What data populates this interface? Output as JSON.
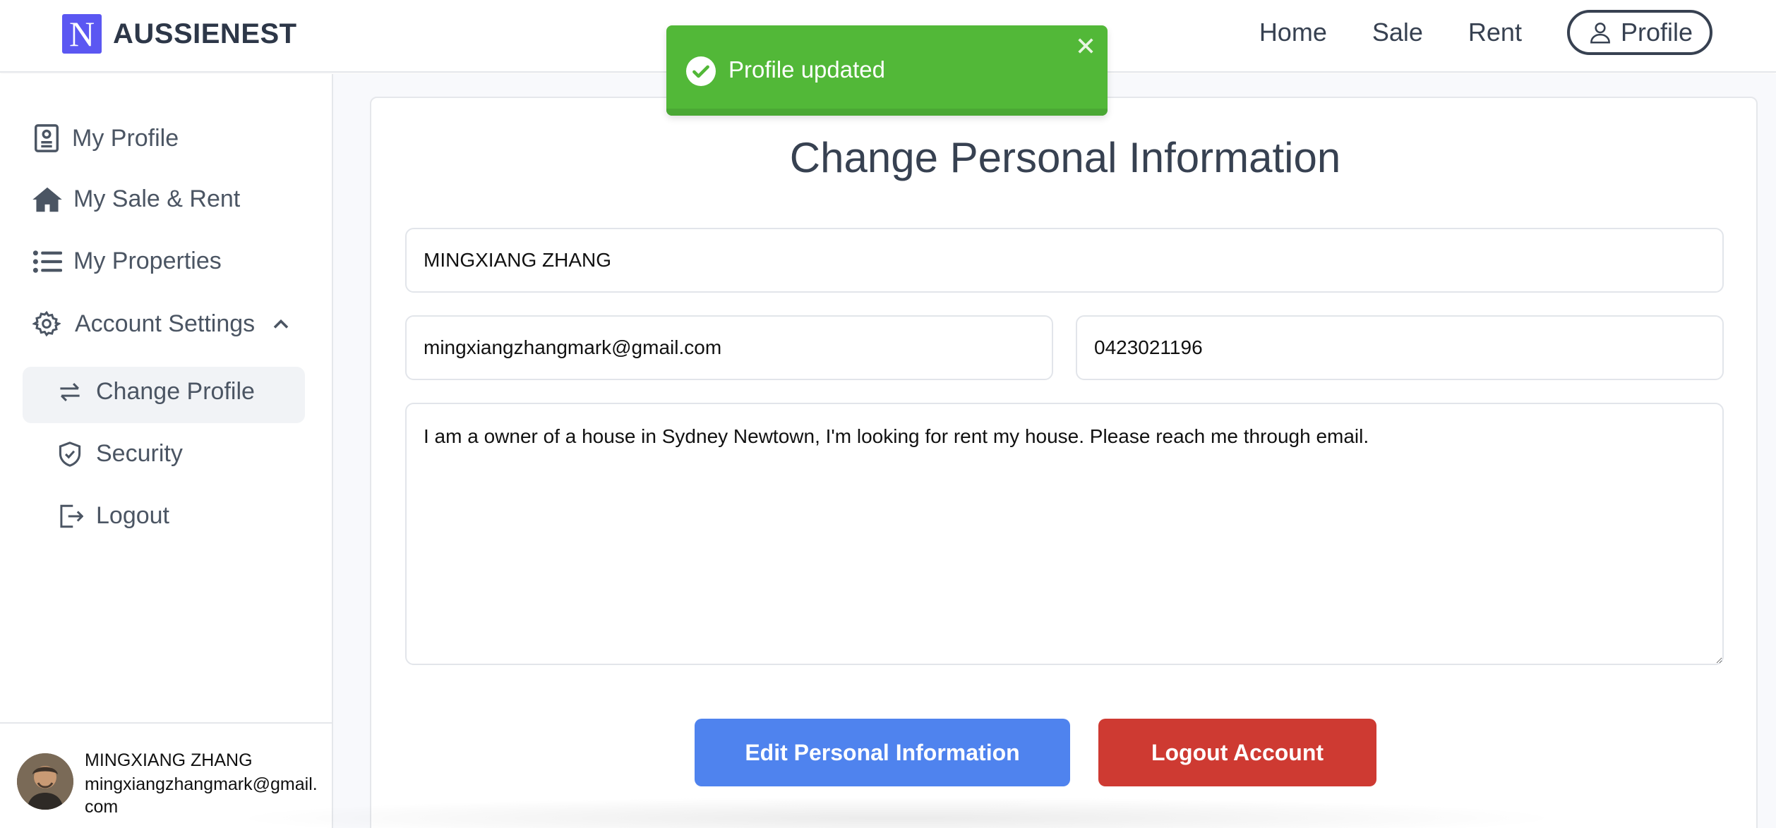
{
  "header": {
    "logo_letter": "N",
    "brand": "AUSSIENEST",
    "nav": {
      "home": "Home",
      "sale": "Sale",
      "rent": "Rent",
      "profile": "Profile"
    }
  },
  "sidebar": {
    "items": {
      "my_profile": "My Profile",
      "my_sale_rent": "My Sale & Rent",
      "my_properties": "My Properties",
      "account_settings": "Account Settings",
      "change_profile": "Change Profile",
      "security": "Security",
      "logout": "Logout"
    },
    "user": {
      "name": "MINGXIANG ZHANG",
      "email": "mingxiangzhangmark@gmail.com"
    }
  },
  "main": {
    "title": "Change Personal Information",
    "form": {
      "name": "MINGXIANG ZHANG",
      "email": "mingxiangzhangmark@gmail.com",
      "phone": "0423021196",
      "bio": "I am a owner of a house in Sydney Newtown, I'm looking for rent my house. Please reach me through email."
    },
    "buttons": {
      "edit": "Edit Personal Information",
      "logout": "Logout Account"
    }
  },
  "toast": {
    "message": "Profile updated",
    "color": "#52b838"
  },
  "colors": {
    "brand": "#5b57f2",
    "primary": "#4f83ee",
    "danger": "#ce3a32"
  }
}
